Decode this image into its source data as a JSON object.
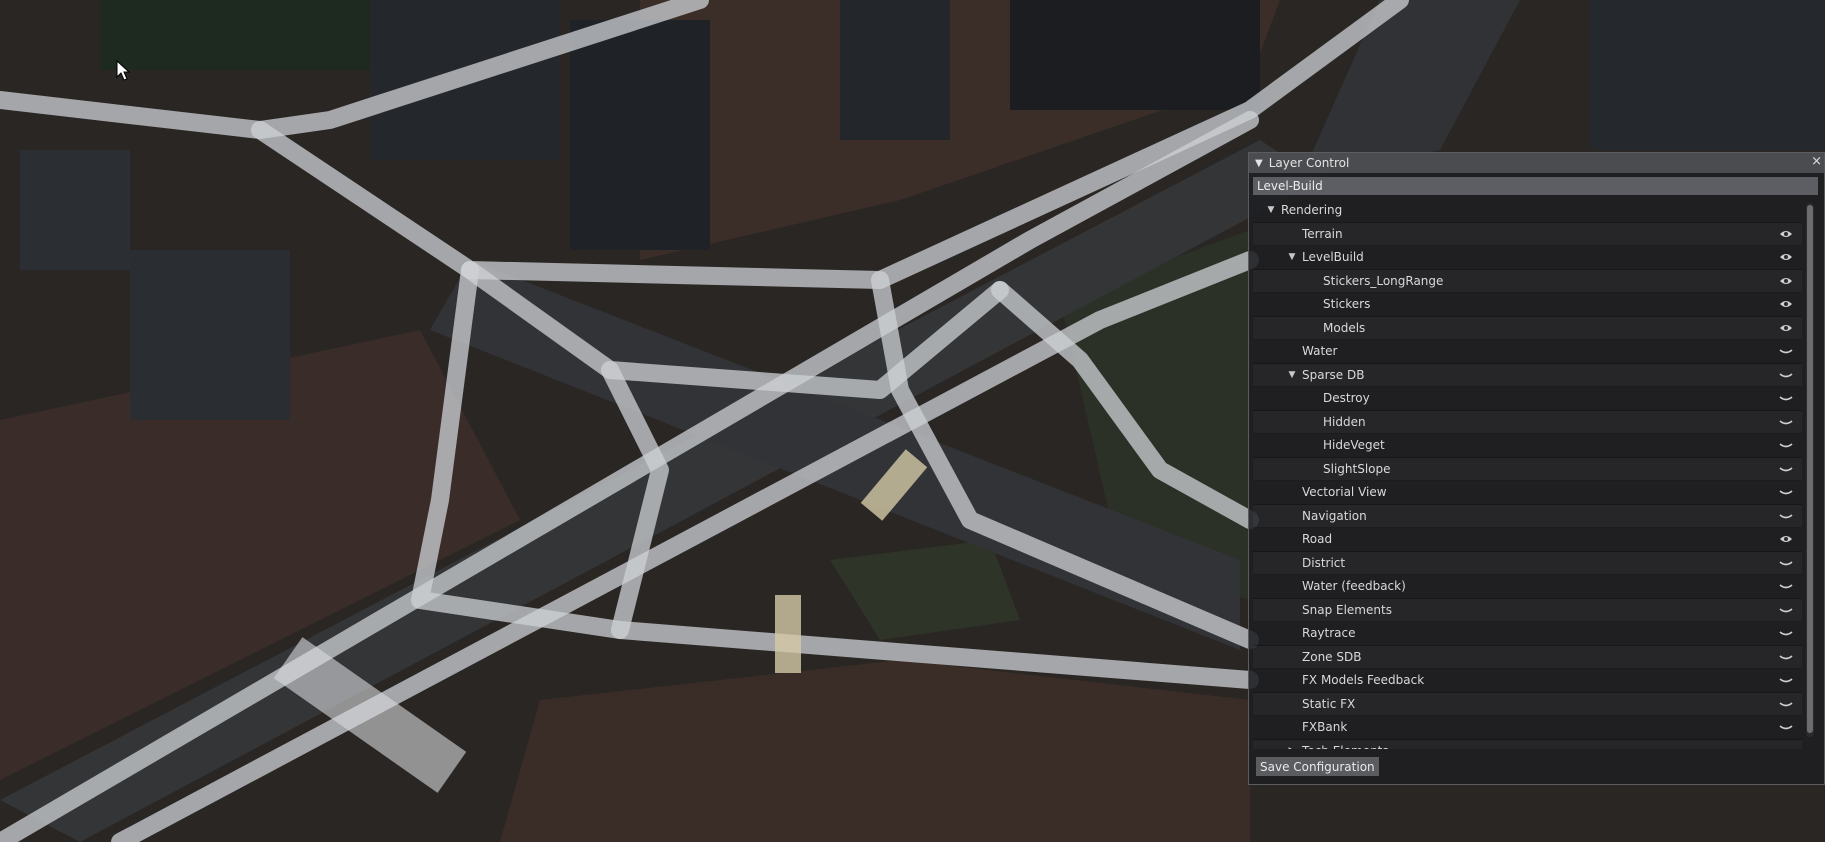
{
  "panel": {
    "title": "Layer Control",
    "close_glyph": "×",
    "collapse_glyph": "▼",
    "level_name": "Level-Build",
    "save_label": "Save Configuration",
    "items": [
      {
        "label": "Rendering",
        "depth": 0,
        "arrow": "▼",
        "visibility": "none"
      },
      {
        "label": "Terrain",
        "depth": 1,
        "arrow": "",
        "visibility": "visible"
      },
      {
        "label": "LevelBuild",
        "depth": 1,
        "arrow": "▼",
        "visibility": "visible"
      },
      {
        "label": "Stickers_LongRange",
        "depth": 2,
        "arrow": "",
        "visibility": "visible"
      },
      {
        "label": "Stickers",
        "depth": 2,
        "arrow": "",
        "visibility": "visible"
      },
      {
        "label": "Models",
        "depth": 2,
        "arrow": "",
        "visibility": "visible"
      },
      {
        "label": "Water",
        "depth": 1,
        "arrow": "",
        "visibility": "hidden"
      },
      {
        "label": "Sparse DB",
        "depth": 1,
        "arrow": "▼",
        "visibility": "hidden"
      },
      {
        "label": "Destroy",
        "depth": 2,
        "arrow": "",
        "visibility": "hidden"
      },
      {
        "label": "Hidden",
        "depth": 2,
        "arrow": "",
        "visibility": "hidden"
      },
      {
        "label": "HideVeget",
        "depth": 2,
        "arrow": "",
        "visibility": "hidden"
      },
      {
        "label": "SlightSlope",
        "depth": 2,
        "arrow": "",
        "visibility": "hidden"
      },
      {
        "label": "Vectorial View",
        "depth": 1,
        "arrow": "",
        "visibility": "hidden"
      },
      {
        "label": "Navigation",
        "depth": 1,
        "arrow": "",
        "visibility": "hidden"
      },
      {
        "label": "Road",
        "depth": 1,
        "arrow": "",
        "visibility": "visible"
      },
      {
        "label": "District",
        "depth": 1,
        "arrow": "",
        "visibility": "hidden"
      },
      {
        "label": "Water (feedback)",
        "depth": 1,
        "arrow": "",
        "visibility": "hidden"
      },
      {
        "label": "Snap Elements",
        "depth": 1,
        "arrow": "",
        "visibility": "hidden"
      },
      {
        "label": "Raytrace",
        "depth": 1,
        "arrow": "",
        "visibility": "hidden"
      },
      {
        "label": "Zone SDB",
        "depth": 1,
        "arrow": "",
        "visibility": "hidden"
      },
      {
        "label": "FX Models Feedback",
        "depth": 1,
        "arrow": "",
        "visibility": "hidden"
      },
      {
        "label": "Static FX",
        "depth": 1,
        "arrow": "",
        "visibility": "hidden"
      },
      {
        "label": "FXBank",
        "depth": 1,
        "arrow": "",
        "visibility": "hidden"
      },
      {
        "label": "Tech Elements",
        "depth": 1,
        "arrow": "▶",
        "visibility": "hidden"
      }
    ]
  },
  "colors": {
    "panel_bg": "#1e1f22",
    "title_bg": "#4a4c50",
    "level_bg": "#5c5e63",
    "road_overlay": "#cfd2d6",
    "asphalt": "#2e3033",
    "terrain": "#3a2f2a",
    "grass": "#2c3126"
  }
}
